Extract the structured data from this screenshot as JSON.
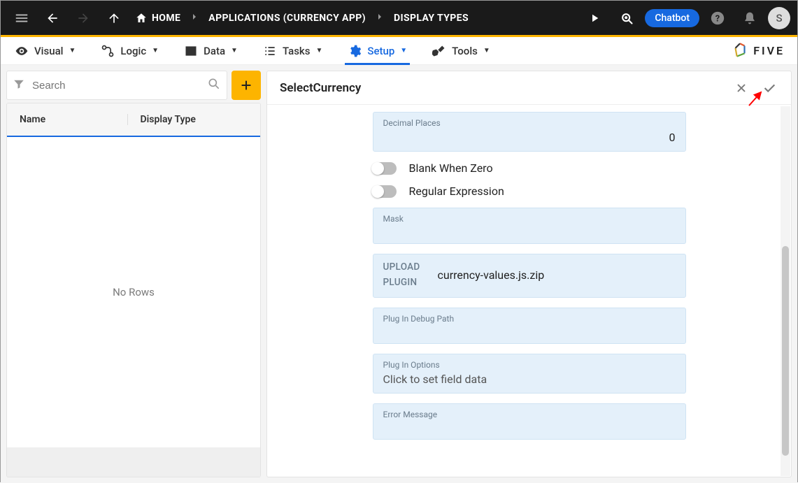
{
  "topbar": {
    "home": "HOME",
    "crumb1": "APPLICATIONS (CURRENCY APP)",
    "crumb2": "DISPLAY TYPES",
    "chatbot": "Chatbot",
    "avatar": "S"
  },
  "tabs": {
    "visual": "Visual",
    "logic": "Logic",
    "data": "Data",
    "tasks": "Tasks",
    "setup": "Setup",
    "tools": "Tools"
  },
  "logo": {
    "text": "FIVE"
  },
  "left": {
    "search_placeholder": "Search",
    "col_name": "Name",
    "col_display_type": "Display Type",
    "no_rows": "No Rows"
  },
  "right": {
    "title": "SelectCurrency",
    "decimal_label": "Decimal Places",
    "decimal_value": "0",
    "blank_zero": "Blank When Zero",
    "regex": "Regular Expression",
    "mask_label": "Mask",
    "upload_left_a": "UPLOAD",
    "upload_left_b": "PLUGIN",
    "upload_file": "currency-values.js.zip",
    "debug_path": "Plug In Debug Path",
    "options_label": "Plug In Options",
    "options_value": "Click to set field data",
    "error_label": "Error Message"
  }
}
